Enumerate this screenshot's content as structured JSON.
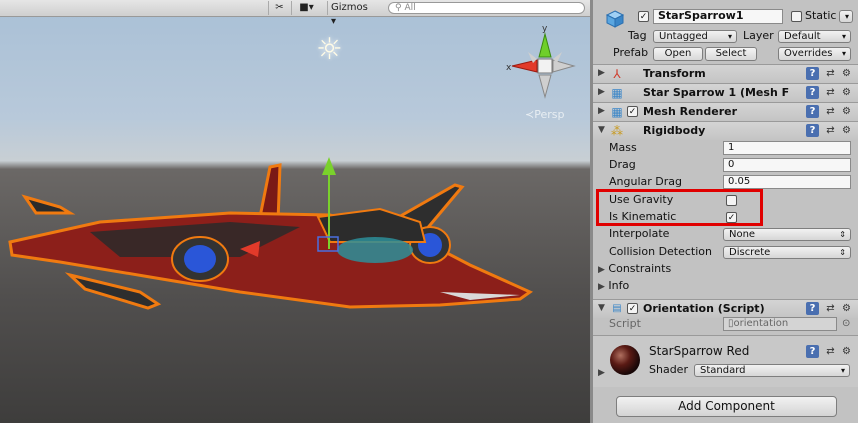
{
  "scene": {
    "toolbar": {
      "fx_icon": "effects-toggle-icon",
      "camera_icon": "camera-icon",
      "gizmos_label": "Gizmos",
      "gizmos_arrow": "▾",
      "search_placeholder": "All"
    },
    "persp_label": "≺Persp",
    "gizmo_axes": {
      "y": "y",
      "x": "x"
    }
  },
  "inspector": {
    "object_name": "StarSparrow1",
    "static_label": "Static",
    "tag_label": "Tag",
    "tag_value": "Untagged",
    "layer_label": "Layer",
    "layer_value": "Default",
    "prefab_label": "Prefab",
    "prefab_buttons": {
      "open": "Open",
      "select": "Select",
      "overrides": "Overrides"
    },
    "components": {
      "transform": {
        "title": "Transform"
      },
      "mesh_filter": {
        "title": "Star Sparrow 1 (Mesh F"
      },
      "mesh_renderer": {
        "title": "Mesh Renderer"
      },
      "rigidbody": {
        "title": "Rigidbody",
        "mass_label": "Mass",
        "mass_value": "1",
        "drag_label": "Drag",
        "drag_value": "0",
        "angular_drag_label": "Angular Drag",
        "angular_drag_value": "0.05",
        "use_gravity_label": "Use Gravity",
        "use_gravity_checked": "",
        "is_kinematic_label": "Is Kinematic",
        "is_kinematic_checked": "✓",
        "interpolate_label": "Interpolate",
        "interpolate_value": "None",
        "collision_label": "Collision Detection",
        "collision_value": "Discrete",
        "constraints_label": "Constraints",
        "info_label": "Info"
      },
      "orientation": {
        "title": "Orientation (Script)",
        "script_label": "Script",
        "script_value": "orientation"
      }
    },
    "material": {
      "name": "StarSparrow Red",
      "shader_label": "Shader",
      "shader_value": "Standard"
    },
    "add_component_label": "Add Component"
  },
  "colors": {
    "highlight_box": "#e00000",
    "selection_outline": "#f07a10",
    "ship_body": "#8c1f1a"
  }
}
